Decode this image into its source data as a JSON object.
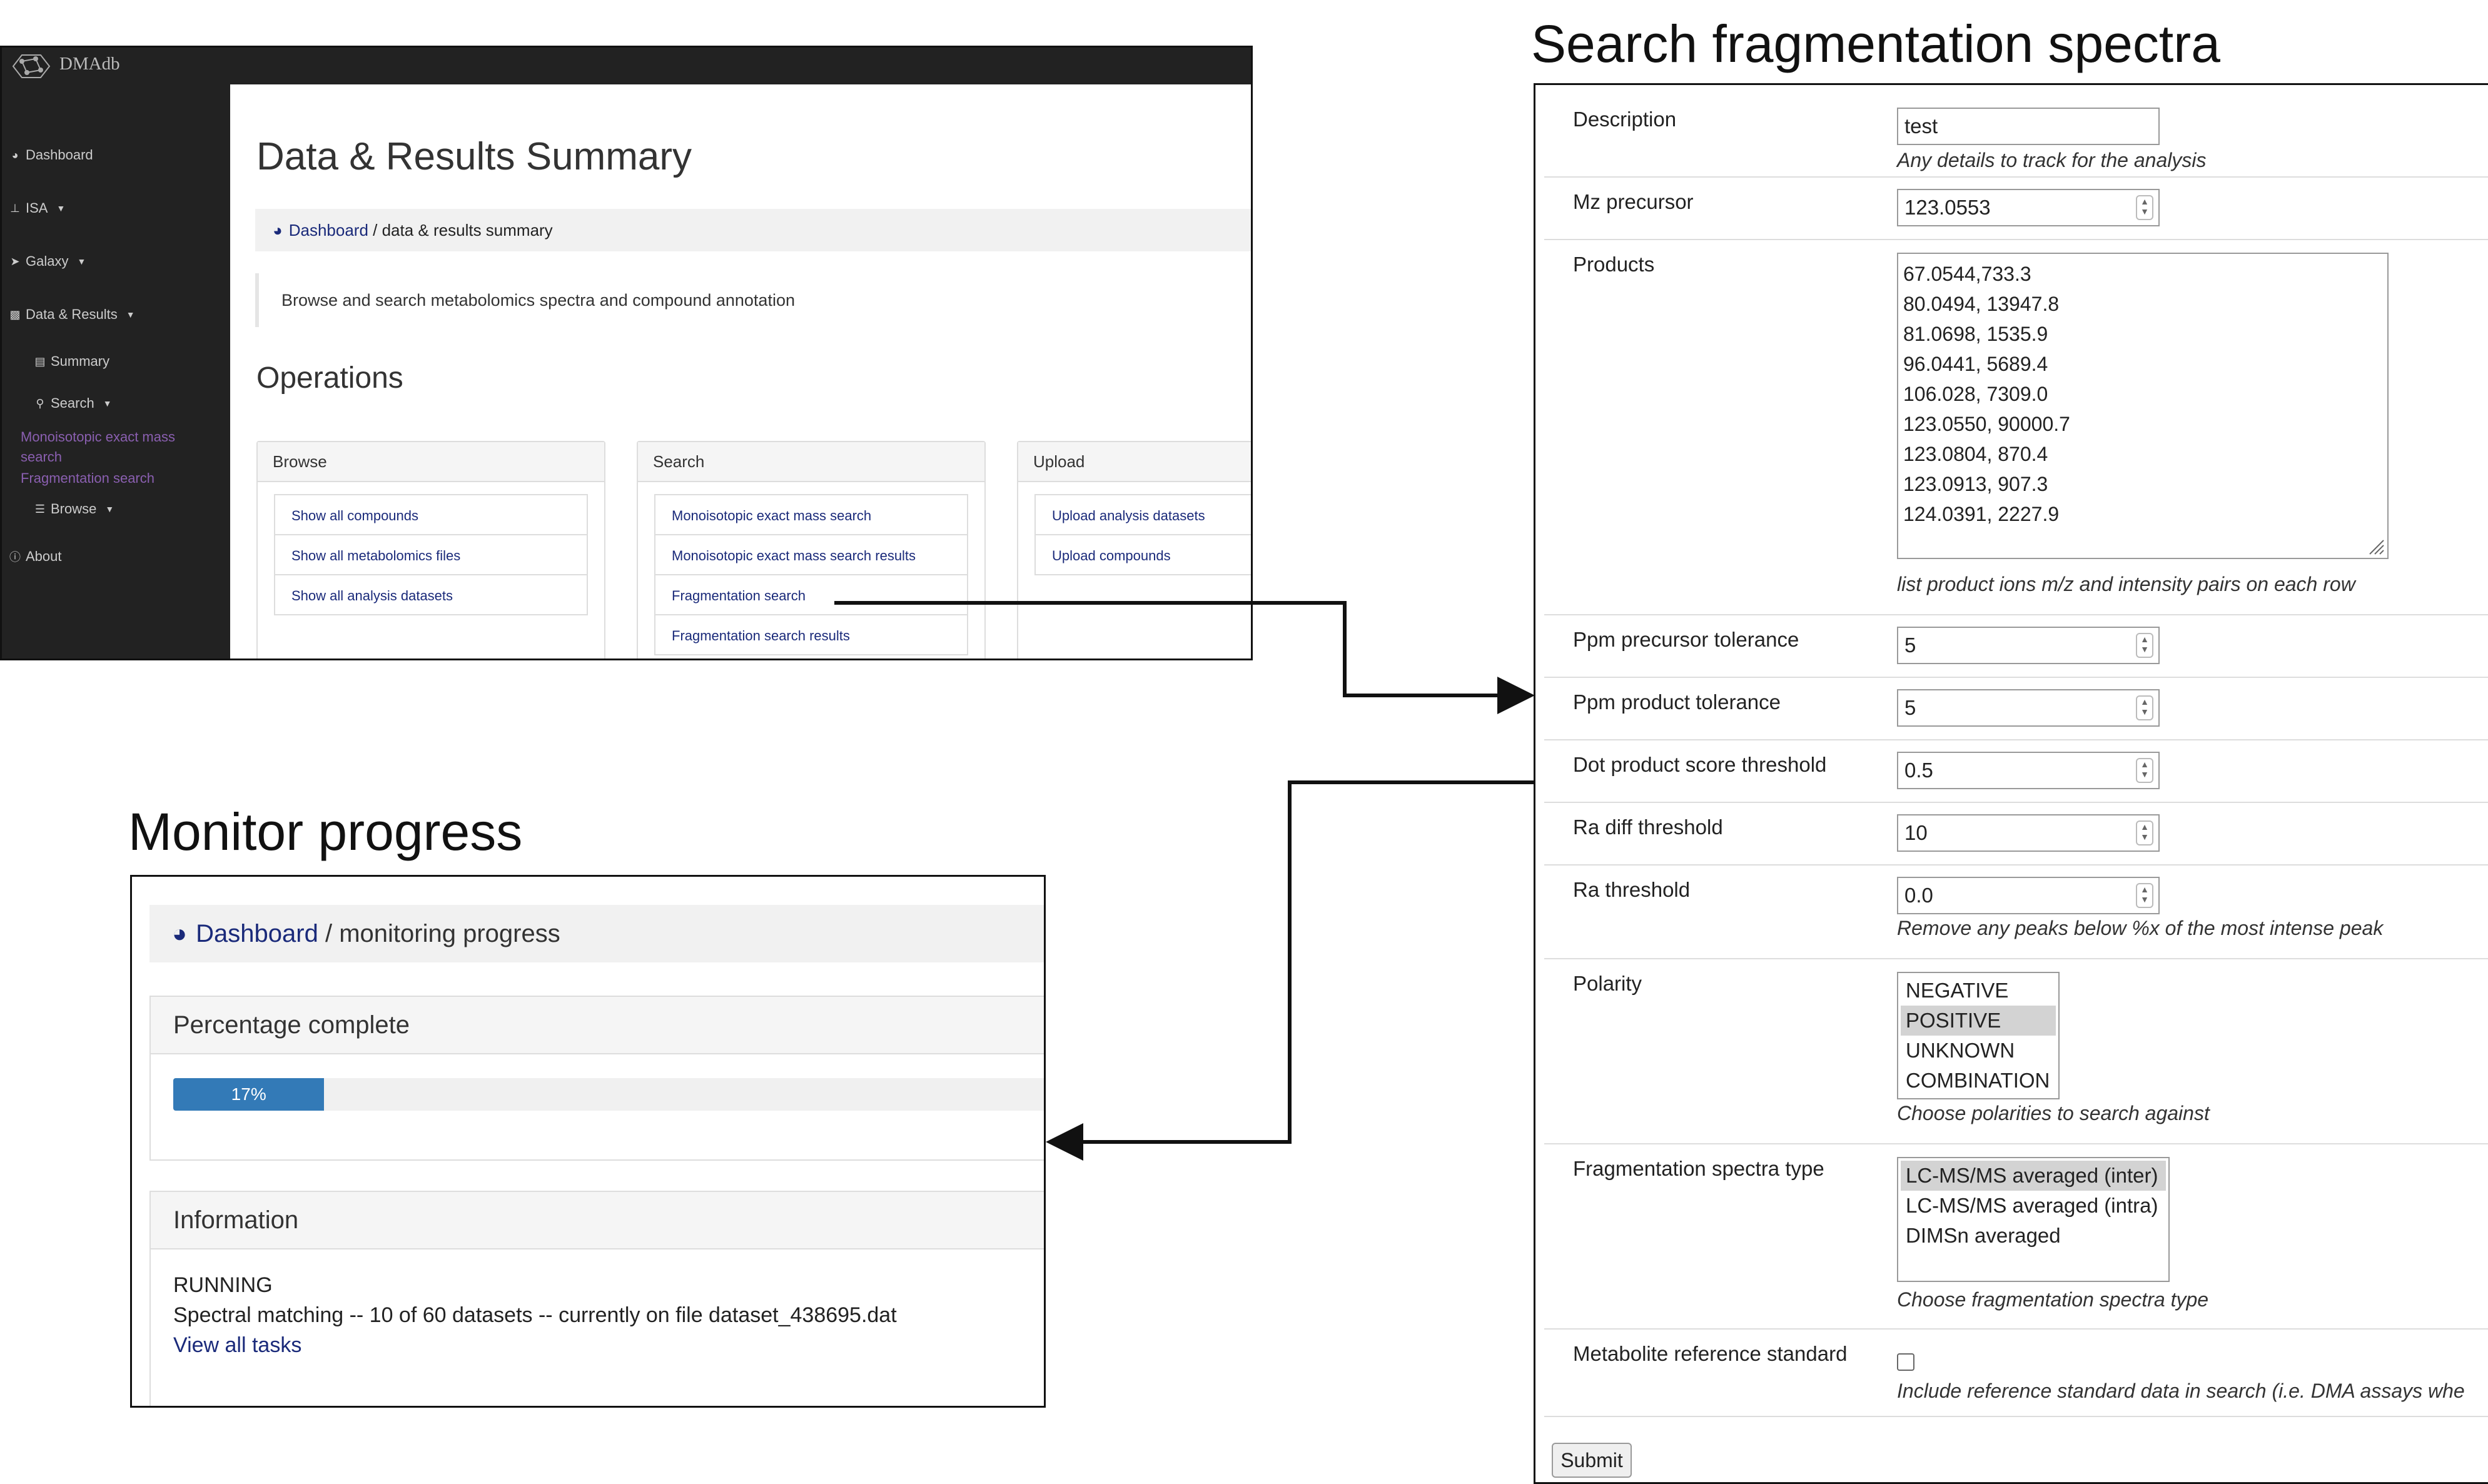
{
  "app": {
    "name": "DMAdb",
    "sidebar": {
      "dashboard": "Dashboard",
      "isa": "ISA",
      "galaxy": "Galaxy",
      "data_results": "Data & Results",
      "summary": "Summary",
      "search": "Search",
      "monoisotopic": "Monoisotopic exact mass search",
      "fragmentation": "Fragmentation search",
      "browse": "Browse",
      "about": "About"
    },
    "page_title": "Data & Results Summary",
    "breadcrumb": {
      "link": "Dashboard",
      "rest": " / data & results summary"
    },
    "intro": "Browse and search metabolomics spectra and compound annotation",
    "operations_title": "Operations",
    "panels": {
      "browse": {
        "title": "Browse",
        "items": [
          "Show all compounds",
          "Show all metabolomics files",
          "Show all analysis datasets"
        ]
      },
      "search": {
        "title": "Search",
        "items": [
          "Monoisotopic exact mass search",
          "Monoisotopic exact mass search results",
          "Fragmentation search",
          "Fragmentation search results"
        ]
      },
      "upload": {
        "title": "Upload",
        "items": [
          "Upload analysis datasets",
          "Upload compounds"
        ]
      }
    }
  },
  "form": {
    "title": "Search fragmentation spectra",
    "description": {
      "label": "Description",
      "value": "test",
      "hint": "Any details to track for the analysis"
    },
    "mz_precursor": {
      "label": "Mz precursor",
      "value": "123.0553"
    },
    "products": {
      "label": "Products",
      "lines": [
        "67.0544,733.3",
        "80.0494, 13947.8",
        "81.0698, 1535.9",
        "96.0441, 5689.4",
        "106.028, 7309.0",
        "123.0550, 90000.7",
        "123.0804, 870.4",
        "123.0913, 907.3",
        "124.0391, 2227.9"
      ],
      "hint": "list product ions m/z and intensity pairs on each row"
    },
    "ppm_precursor": {
      "label": "Ppm precursor tolerance",
      "value": "5"
    },
    "ppm_product": {
      "label": "Ppm product tolerance",
      "value": "5"
    },
    "dot_product": {
      "label": "Dot product score threshold",
      "value": "0.5"
    },
    "ra_diff": {
      "label": "Ra diff threshold",
      "value": "10"
    },
    "ra_threshold": {
      "label": "Ra threshold",
      "value": "0.0",
      "hint": "Remove any peaks below %x of the most intense peak"
    },
    "polarity": {
      "label": "Polarity",
      "options": [
        "NEGATIVE",
        "POSITIVE",
        "UNKNOWN",
        "COMBINATION"
      ],
      "selected": "POSITIVE",
      "hint": "Choose polarities to search against"
    },
    "spectra_type": {
      "label": "Fragmentation spectra type",
      "options": [
        "LC-MS/MS averaged (inter)",
        "LC-MS/MS averaged (intra)",
        "DIMSn averaged"
      ],
      "selected": "LC-MS/MS averaged (inter)",
      "hint": "Choose fragmentation spectra type"
    },
    "ref_standard": {
      "label": "Metabolite reference standard",
      "checked": false,
      "hint": "Include reference standard data in search (i.e. DMA assays whe"
    },
    "submit_label": "Submit"
  },
  "monitor": {
    "title": "Monitor progress",
    "breadcrumb": {
      "link": "Dashboard",
      "rest": " / monitoring progress"
    },
    "percentage_title": "Percentage complete",
    "progress": 0.17,
    "progress_label": "17%",
    "information_title": "Information",
    "status": "RUNNING",
    "detail": "Spectral matching -- 10 of 60 datasets -- currently on file dataset_438695.dat",
    "view_all": "View all tasks"
  },
  "colors": {
    "sidebar": "#222222",
    "link": "#1a2a7a",
    "progress": "#337ab7",
    "sidebar_active_link": "#8a5fb0"
  }
}
